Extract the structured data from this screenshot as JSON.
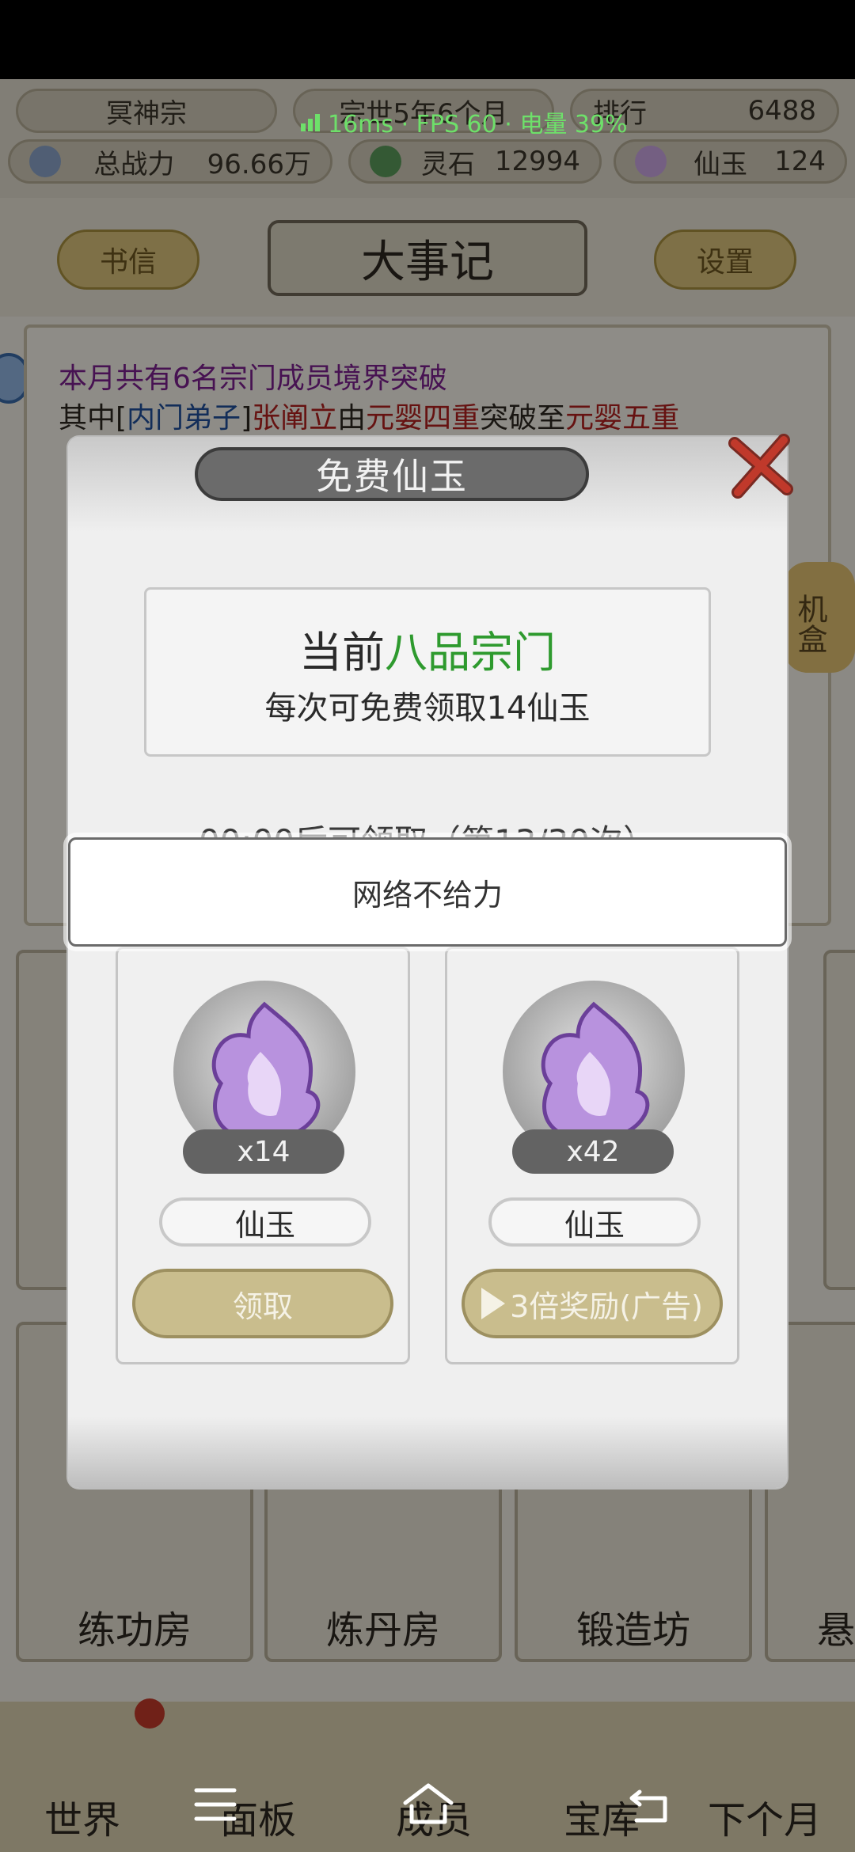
{
  "perf_overlay": "16ms · FPS 60 · 电量 39%",
  "hud": {
    "sect_name": "冥神宗",
    "date": "宗世5年6个月",
    "rank_label": "排行",
    "rank_value": "6488",
    "power_label": "总战力",
    "power_value": "96.66万",
    "stone_label": "灵石",
    "stone_value": "12994",
    "jade_label": "仙玉",
    "jade_value": "124"
  },
  "header": {
    "letters_button": "书信",
    "title": "大事记",
    "settings_button": "设置"
  },
  "chronicle": {
    "line1": "本月共有6名宗门成员境界突破",
    "line2_prefix": "其中[",
    "line2_role": "内门弟子",
    "line2_mid": "]",
    "line2_name": "张阐立",
    "line2_from_word": "由",
    "line2_from": "元婴四重",
    "line2_to_word": "突破至",
    "line2_to": "元婴五重"
  },
  "right_deco_text": "机盒",
  "buildings": {
    "labels": [
      "练功房",
      "炼丹房",
      "锻造坊",
      "悬"
    ]
  },
  "bottom_nav": {
    "items": [
      "世界",
      "面板",
      "成员",
      "宝库",
      "下个月"
    ]
  },
  "modal": {
    "title": "免费仙玉",
    "grade_prefix": "当前",
    "grade": "八品宗门",
    "free_desc": "每次可免费领取14仙玉",
    "countdown": "00:00后可领取（第13/30次）",
    "cards": [
      {
        "count": "x14",
        "name": "仙玉",
        "action": "领取"
      },
      {
        "count": "x42",
        "name": "仙玉",
        "action": "3倍奖励(广告)"
      }
    ]
  },
  "toast": "网络不给力",
  "colors": {
    "grade_green": "#2e9a2e",
    "perf_green": "#6ee06a",
    "close_red": "#c0392b",
    "orb_purple": "#a47bd0"
  }
}
